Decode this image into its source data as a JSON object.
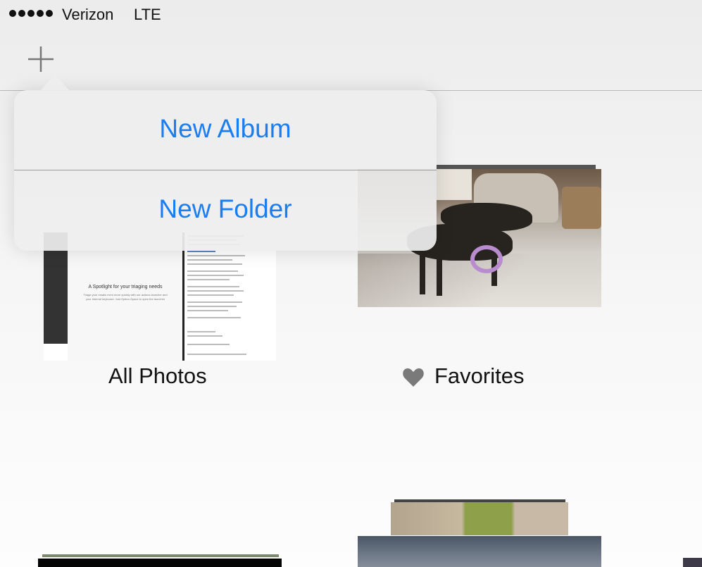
{
  "status_bar": {
    "signal_bars": 5,
    "carrier": "Verizon",
    "network": "LTE"
  },
  "nav": {
    "add_icon": "plus-icon"
  },
  "popover": {
    "items": [
      {
        "label": "New Album"
      },
      {
        "label": "New Folder"
      }
    ]
  },
  "albums": [
    {
      "label": "All Photos",
      "thumbnail": {
        "title": "A Spotlight for your triaging needs",
        "subtitle": "Triage your emails even more quickly with our actions launcher and your internal keyboard. Just Option-Space to open the launcher"
      }
    },
    {
      "label": "Favorites",
      "icon": "heart-icon"
    }
  ],
  "colors": {
    "accent": "#1a7df0",
    "text": "#111111",
    "separator": "#b9b9b9"
  }
}
